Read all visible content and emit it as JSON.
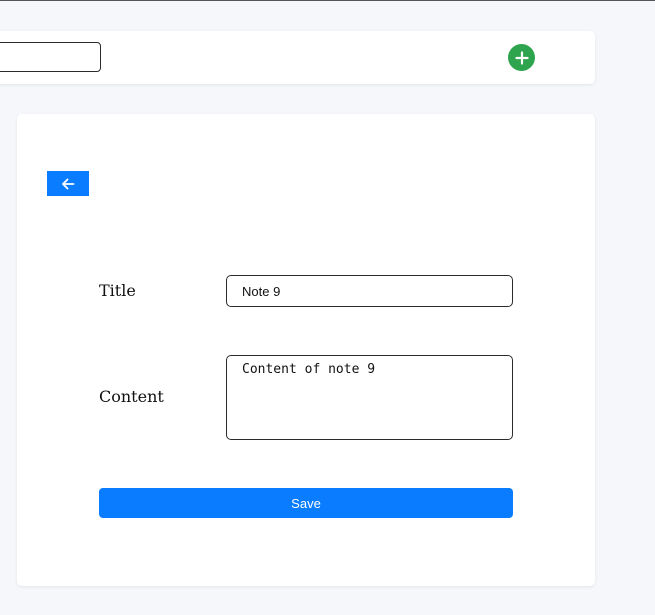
{
  "header": {
    "search": {
      "value": "",
      "placeholder": ""
    },
    "add_icon": "plus-icon",
    "add_color": "#2ea44f"
  },
  "editor": {
    "back_icon": "arrow-left-icon",
    "title_label": "Title",
    "title_value": "Note 9",
    "content_label": "Content",
    "content_value": "Content of note 9",
    "save_label": "Save",
    "accent_color": "#0a7cff"
  }
}
